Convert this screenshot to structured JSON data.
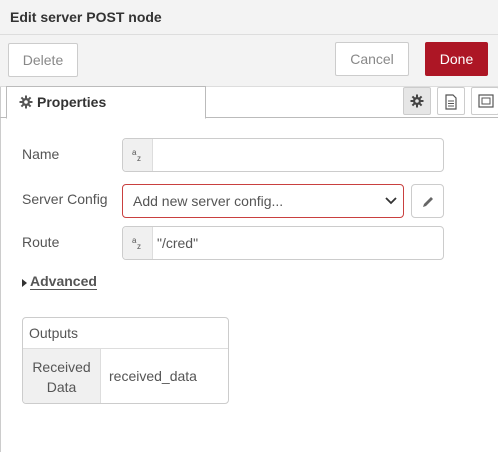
{
  "title_bar": {
    "title": "Edit server POST node"
  },
  "buttons": {
    "delete": "Delete",
    "cancel": "Cancel",
    "done": "Done"
  },
  "tabs": {
    "properties": "Properties"
  },
  "form": {
    "name": {
      "label": "Name",
      "value": ""
    },
    "server_config": {
      "label": "Server Config",
      "selected": "Add new server config..."
    },
    "route": {
      "label": "Route",
      "value": "\"/cred\""
    }
  },
  "advanced": {
    "label": "Advanced"
  },
  "outputs": {
    "header": "Outputs",
    "rows": [
      {
        "key_line1": "Received",
        "key_line2": "Data",
        "value": "received_data"
      }
    ]
  },
  "icons": {
    "tab": "gear-icon",
    "tab_buttons": [
      "gear-icon",
      "document-icon",
      "frame-icon"
    ],
    "type_prefix": "string-type-icon",
    "edit": "pencil-icon"
  },
  "colors": {
    "accent": "#ad1625",
    "error_border": "#c9403f"
  }
}
